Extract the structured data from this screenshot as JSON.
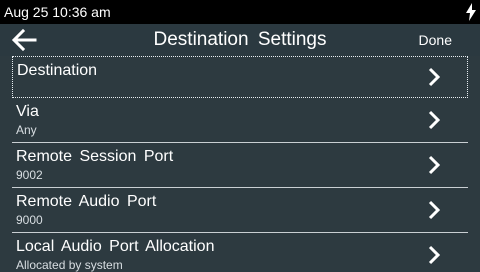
{
  "statusbar": {
    "time": "Aug 25 10:36 am",
    "icon": "charging-bolt-icon"
  },
  "appbar": {
    "back_icon": "back-arrow-icon",
    "title": "Destination  Settings",
    "done_label": "Done"
  },
  "rows": [
    {
      "label": "Destination",
      "sub": "",
      "focused": true
    },
    {
      "label": "Via",
      "sub": "Any"
    },
    {
      "label": "Remote  Session Port",
      "sub": "9002"
    },
    {
      "label": "Remote  Audio Port",
      "sub": "9000"
    },
    {
      "label": "Local Audio Port Allocation",
      "sub": "Allocated by system"
    }
  ],
  "colors": {
    "background": "#2d3a40",
    "statusbar": "#000000",
    "text": "#ffffff"
  }
}
